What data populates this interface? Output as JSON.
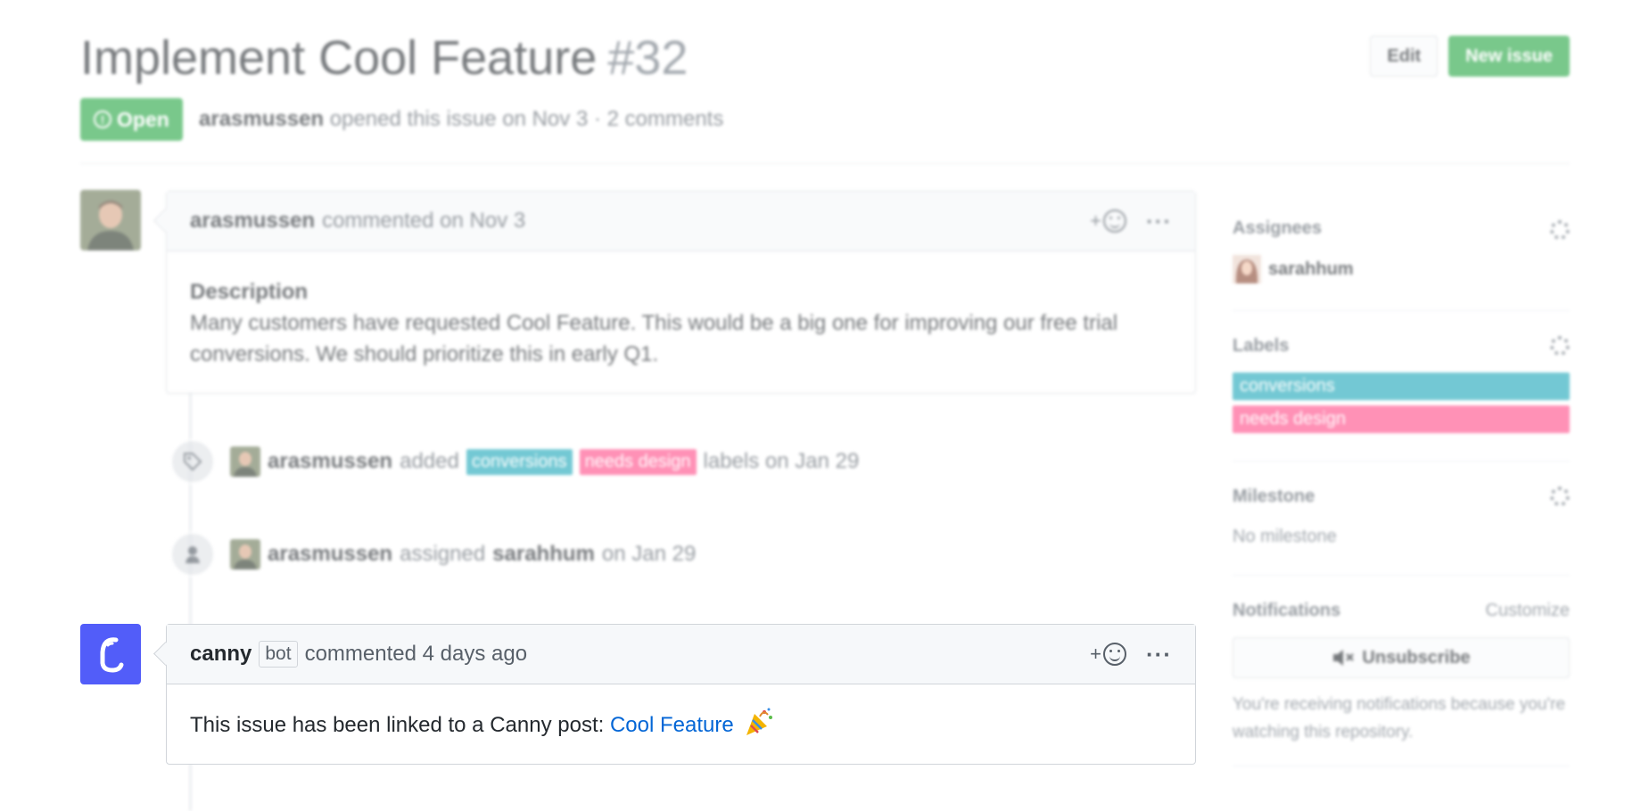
{
  "issue": {
    "title": "Implement Cool Feature",
    "number": "#32",
    "state": "Open",
    "author": "arasmussen",
    "opened_text": "opened this issue on Nov 3 · 2 comments"
  },
  "header_buttons": {
    "edit": "Edit",
    "new_issue": "New issue"
  },
  "comments": [
    {
      "author": "arasmussen",
      "time": "commented on Nov 3",
      "description_title": "Description",
      "body": "Many customers have requested Cool Feature. This would be a big one for improving our free trial conversions. We should prioritize this in early Q1."
    },
    {
      "author": "canny",
      "badge": "bot",
      "time": "commented 4 days ago",
      "body": "This issue has been linked to a Canny post: ",
      "link_text": "Cool Feature"
    }
  ],
  "events": [
    {
      "actor": "arasmussen",
      "action": "added",
      "labels": [
        "conversions",
        "needs design"
      ],
      "suffix": "labels on Jan 29"
    },
    {
      "actor": "arasmussen",
      "action": "assigned",
      "target": "sarahhum",
      "suffix": "on Jan 29"
    }
  ],
  "sidebar": {
    "assignees": {
      "title": "Assignees",
      "user": "sarahhum"
    },
    "labels": {
      "title": "Labels",
      "items": [
        "conversions",
        "needs design"
      ]
    },
    "milestone": {
      "title": "Milestone",
      "value": "No milestone"
    },
    "notifications": {
      "title": "Notifications",
      "customize": "Customize",
      "button": "Unsubscribe",
      "note": "You're receiving notifications because you're watching this repository."
    }
  },
  "colors": {
    "open_green": "#28a745",
    "label_conversions": "#1fa8ba",
    "label_needs_design": "#ff4e8a",
    "canny_blue": "#525df9",
    "link_blue": "#0366d6"
  },
  "icons": [
    "info-circle-icon",
    "smiley-icon",
    "kebab-icon",
    "tag-icon",
    "person-icon",
    "gear-icon",
    "mute-icon",
    "canny-logo-icon",
    "party-popper-icon"
  ]
}
